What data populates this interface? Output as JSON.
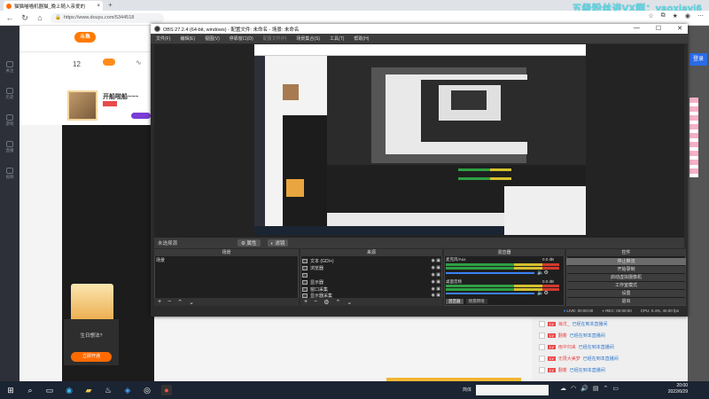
{
  "browser": {
    "tab_title": "猫猫喵喵机器猫_晚上随入亲爱的",
    "tab_close": "×",
    "new_tab": "+",
    "url": "https://www.douyu.com/5344518",
    "watermark": "五级粉丝进VX群：yaoxiayi6"
  },
  "douyu": {
    "logo": "斗鱼",
    "room_title": "开船啦船~~~",
    "stats": [
      "12",
      "",
      ""
    ],
    "gift_title": "生日想法?",
    "gift_button": "立即开通",
    "sidebar": [
      "关注",
      "历史",
      "游戏",
      "直播",
      "视频"
    ],
    "sign_in": "登录",
    "chat": [
      {
        "level": "Lv",
        "name": "海洋_",
        "msg": "已经在到本直播间"
      },
      {
        "level": "Lv",
        "name": "翻着",
        "msg": "已经在到本直播间"
      },
      {
        "level": "Lv",
        "name": "雨中归来",
        "msg": "已经在到本直播间"
      },
      {
        "level": "Lv",
        "name": "无限大美梦",
        "msg": "已经在到本直播间"
      },
      {
        "level": "Lv",
        "name": "翻着",
        "msg": "已经在到本直播间"
      }
    ]
  },
  "obs": {
    "title": "OBS 27.2.4 (64-bit, windows) - 配置文件: 未命名 - 场景: 未命名",
    "menu": [
      "文件(F)",
      "编辑(E)",
      "视图(V)",
      "停靠窗口(D)",
      "配置文件(P)",
      "场景集合(S)",
      "工具(T)",
      "帮助(H)"
    ],
    "source_bar": {
      "label": "未选择源",
      "props": "属性",
      "filters": "滤镜"
    },
    "scenes": {
      "header": "场景",
      "items": [
        "场景"
      ]
    },
    "sources": {
      "header": "来源",
      "items": [
        "文本 (GDI+)",
        "浏览器",
        "",
        "显示器",
        "窗口采集",
        "显示器采集"
      ]
    },
    "mixer": {
      "header": "混音器",
      "channels": [
        {
          "name": "麦克风/Aux",
          "db": "0.0 dB"
        },
        {
          "name": "桌面音频",
          "db": "0.0 dB"
        }
      ],
      "tabs": [
        "混音器",
        "场景转场"
      ]
    },
    "controls": {
      "header": "控件",
      "buttons": [
        "停止推流",
        "开始录制",
        "启动虚拟摄像机",
        "工作室模式",
        "设置",
        "退出"
      ]
    },
    "status": {
      "live": "LIVE: 00:00:00",
      "rec": "REC: 00:00:00",
      "cpu": "CPU: 0.4%, 40.00 fps"
    }
  },
  "taskbar": {
    "lang": "简体",
    "time": "20:00",
    "date": "2022/6/29"
  }
}
